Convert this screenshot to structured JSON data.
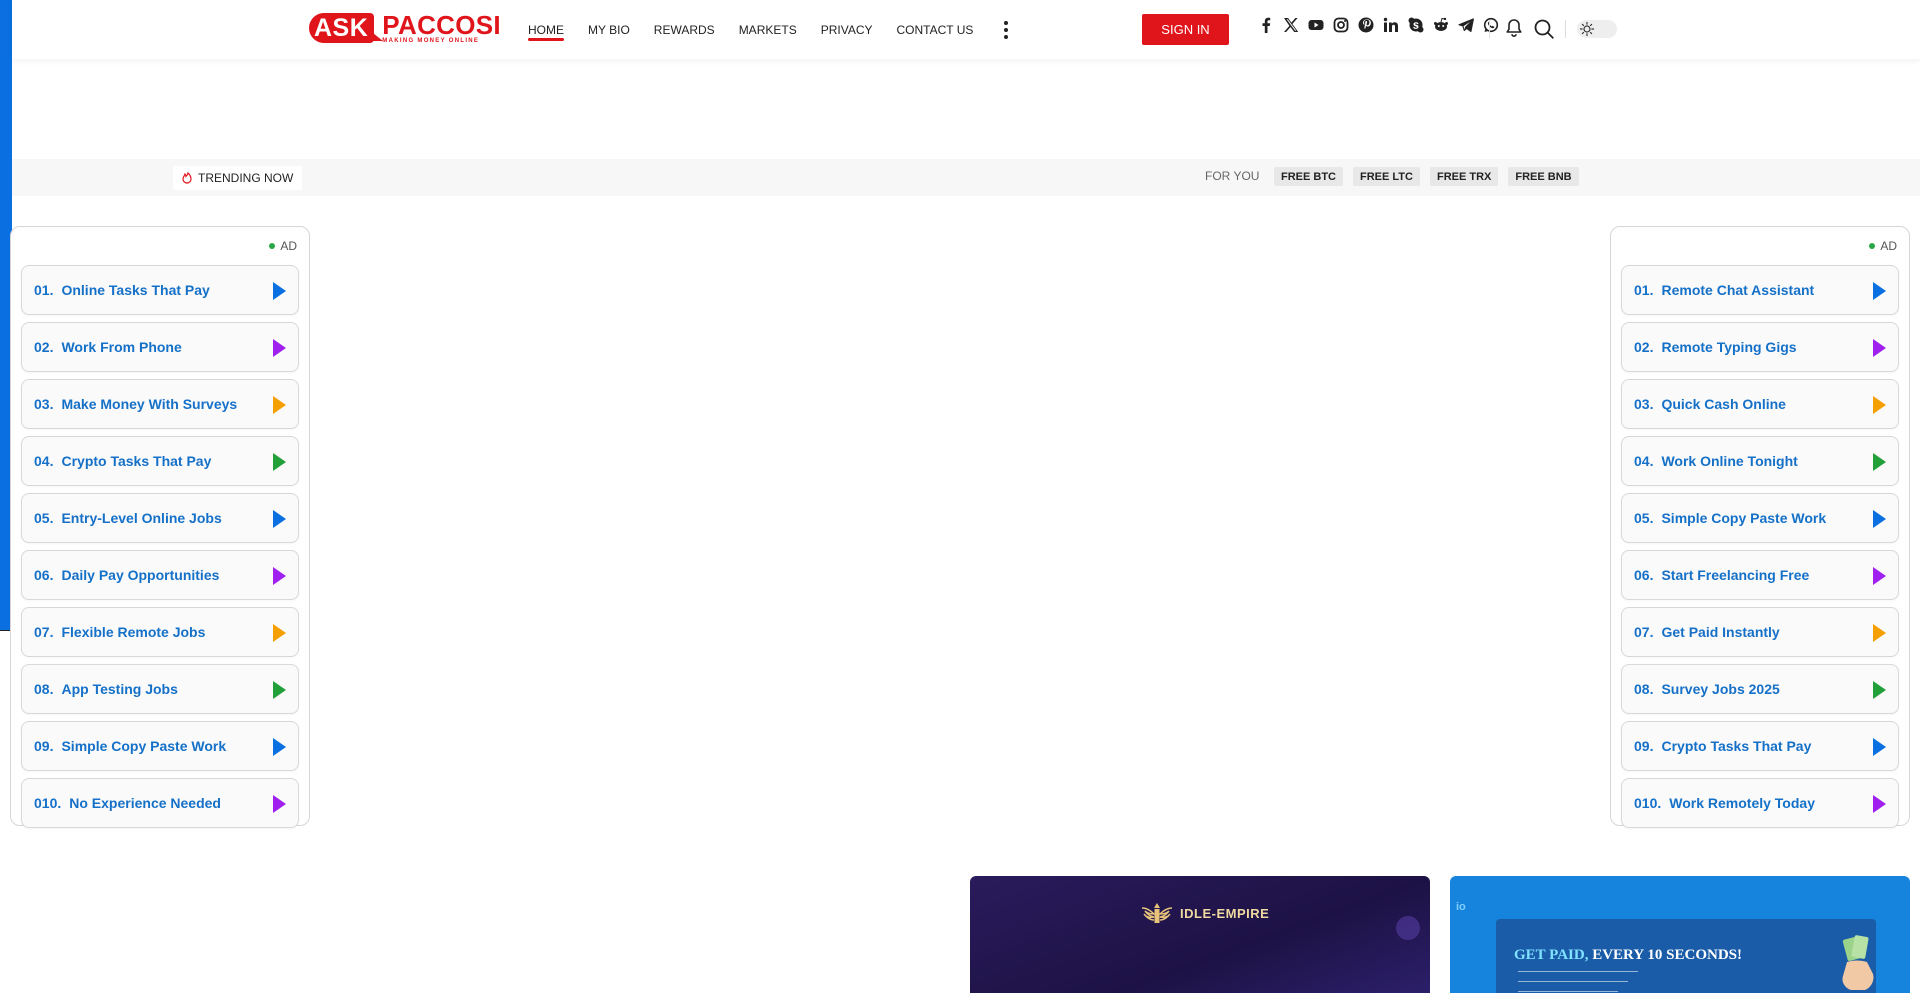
{
  "logo": {
    "ask": "ASK",
    "paccosi": "PACCOSI",
    "tagline": "MAKING MONEY ONLINE"
  },
  "nav": {
    "items": [
      {
        "label": "HOME",
        "active": true
      },
      {
        "label": "MY BIO"
      },
      {
        "label": "REWARDS"
      },
      {
        "label": "MARKETS"
      },
      {
        "label": "PRIVACY"
      },
      {
        "label": "CONTACT US"
      }
    ]
  },
  "header": {
    "signin_label": "SIGN IN",
    "socials": [
      "facebook-icon",
      "x-icon",
      "youtube-icon",
      "instagram-icon",
      "pinterest-icon",
      "linkedin-icon",
      "skype-icon",
      "reddit-icon",
      "telegram-icon",
      "whatsapp-icon"
    ]
  },
  "trending": {
    "label": "TRENDING NOW",
    "foryou_label": "FOR YOU",
    "chips": [
      "FREE BTC",
      "FREE LTC",
      "FREE TRX",
      "FREE BNB"
    ]
  },
  "left_panel": {
    "ad_label": "AD",
    "items": [
      {
        "num": "01.",
        "text": "Online Tasks That Pay",
        "color": "blue"
      },
      {
        "num": "02.",
        "text": "Work From Phone",
        "color": "purple"
      },
      {
        "num": "03.",
        "text": "Make Money With Surveys",
        "color": "orange"
      },
      {
        "num": "04.",
        "text": "Crypto Tasks That Pay",
        "color": "green"
      },
      {
        "num": "05.",
        "text": "Entry-Level Online Jobs",
        "color": "blue"
      },
      {
        "num": "06.",
        "text": "Daily Pay Opportunities",
        "color": "purple"
      },
      {
        "num": "07.",
        "text": "Flexible Remote Jobs",
        "color": "orange"
      },
      {
        "num": "08.",
        "text": "App Testing Jobs",
        "color": "green"
      },
      {
        "num": "09.",
        "text": "Simple Copy Paste Work",
        "color": "blue"
      },
      {
        "num": "010.",
        "text": "No Experience Needed",
        "color": "purple"
      }
    ]
  },
  "right_panel": {
    "ad_label": "AD",
    "items": [
      {
        "num": "01.",
        "text": "Remote Chat Assistant",
        "color": "blue"
      },
      {
        "num": "02.",
        "text": "Remote Typing Gigs",
        "color": "purple"
      },
      {
        "num": "03.",
        "text": "Quick Cash Online",
        "color": "orange"
      },
      {
        "num": "04.",
        "text": "Work Online Tonight",
        "color": "green"
      },
      {
        "num": "05.",
        "text": "Simple Copy Paste Work",
        "color": "blue"
      },
      {
        "num": "06.",
        "text": "Start Freelancing Free",
        "color": "purple"
      },
      {
        "num": "07.",
        "text": "Get Paid Instantly",
        "color": "orange"
      },
      {
        "num": "08.",
        "text": "Survey Jobs 2025",
        "color": "green"
      },
      {
        "num": "09.",
        "text": "Crypto Tasks That Pay",
        "color": "blue"
      },
      {
        "num": "010.",
        "text": "Work Remotely Today",
        "color": "purple"
      }
    ]
  },
  "bottom_ads": {
    "card1_text": "IDLE-EMPIRE",
    "card2_title_a": "GET PAID,",
    "card2_title_b": " EVERY 10 SECONDS!"
  },
  "colors": {
    "accent": "#e0141b",
    "link": "#1570c8"
  }
}
